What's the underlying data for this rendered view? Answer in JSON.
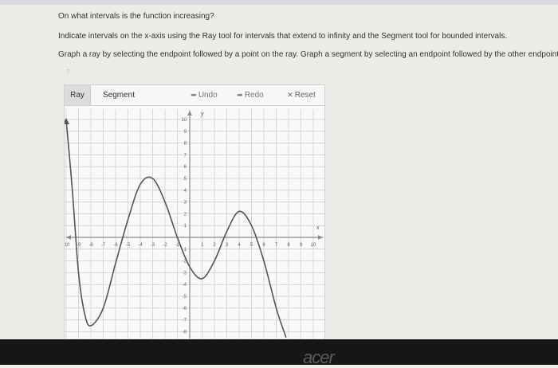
{
  "question": {
    "line1": "On what intervals is the function increasing?",
    "line2": "Indicate intervals on the x-axis using the Ray tool for intervals that extend to infinity and the Segment tool for bounded intervals.",
    "line3": "Graph a ray by selecting the endpoint followed by a point on the ray. Graph a segment by selecting an endpoint followed by the other endpoint."
  },
  "footnote": "?",
  "toolbar": {
    "ray_label": "Ray",
    "segment_label": "Segment",
    "undo_label": "Undo",
    "redo_label": "Redo",
    "reset_label": "Reset",
    "undo_icon": "undo-arrow-icon",
    "redo_icon": "redo-arrow-icon",
    "reset_icon": "x-icon"
  },
  "graph": {
    "x_axis_label": "x",
    "y_axis_label": "y",
    "x_range": [
      -10,
      10
    ],
    "y_range": [
      -8,
      10
    ],
    "x_ticks": [
      -10,
      -9,
      -8,
      -7,
      -6,
      -5,
      -4,
      -3,
      -2,
      -1,
      1,
      2,
      3,
      4,
      5,
      6,
      7,
      8,
      9,
      10
    ],
    "y_ticks": [
      -8,
      -7,
      -6,
      -5,
      -4,
      -3,
      -2,
      -1,
      1,
      2,
      3,
      4,
      5,
      6,
      7,
      8,
      9,
      10
    ],
    "grid": true,
    "curve_color": "#555555",
    "curve_points": [
      [
        -10,
        10
      ],
      [
        -9.5,
        4
      ],
      [
        -9,
        -3
      ],
      [
        -8.5,
        -6.5
      ],
      [
        -8,
        -7.5
      ],
      [
        -7,
        -6
      ],
      [
        -6,
        -2.2
      ],
      [
        -5,
        1.5
      ],
      [
        -4,
        4.5
      ],
      [
        -3,
        5
      ],
      [
        -2,
        3
      ],
      [
        -1,
        0
      ],
      [
        0,
        -2.5
      ],
      [
        1,
        -3.5
      ],
      [
        2,
        -2
      ],
      [
        3,
        0.5
      ],
      [
        4,
        2.2
      ],
      [
        5,
        1
      ],
      [
        6,
        -2
      ],
      [
        7,
        -6
      ],
      [
        7.8,
        -8.5
      ]
    ]
  },
  "device_brand": "acer"
}
